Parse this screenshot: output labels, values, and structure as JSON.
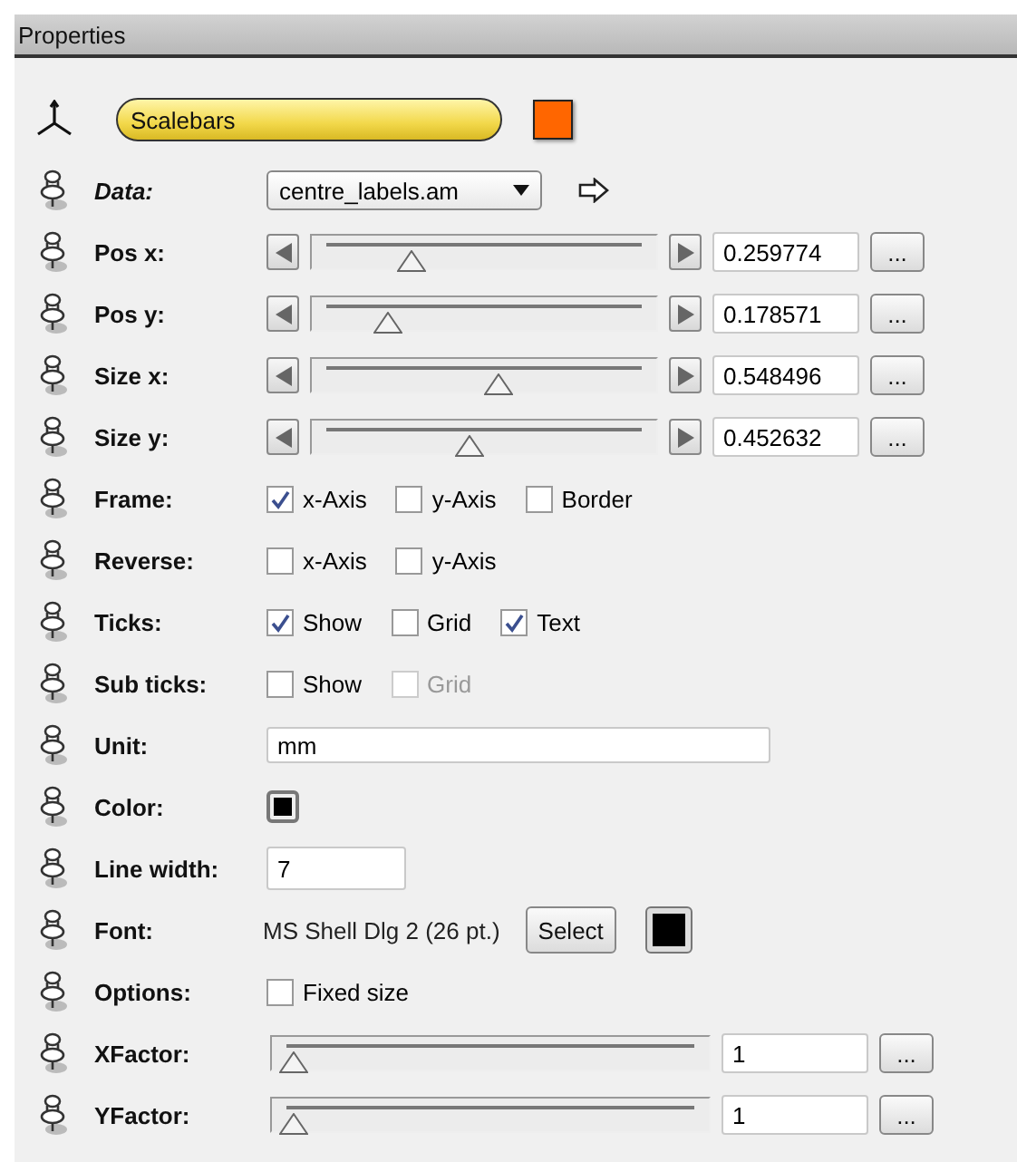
{
  "panel": {
    "title": "Properties"
  },
  "header": {
    "name": "Scalebars",
    "color": "#ff6600"
  },
  "rows": [
    {
      "kind": "dropdown",
      "label": "Data:",
      "italic": true,
      "value": "centre_labels.am"
    },
    {
      "kind": "slider",
      "label": "Pos x:",
      "arrows": true,
      "level": 0.26,
      "value": "0.259774",
      "button": "..."
    },
    {
      "kind": "slider",
      "label": "Pos y:",
      "arrows": true,
      "level": 0.18,
      "value": "0.178571",
      "button": "..."
    },
    {
      "kind": "slider",
      "label": "Size x:",
      "arrows": true,
      "level": 0.55,
      "value": "0.548496",
      "button": "..."
    },
    {
      "kind": "slider",
      "label": "Size y:",
      "arrows": true,
      "level": 0.45,
      "value": "0.452632",
      "button": "..."
    },
    {
      "kind": "checks",
      "label": "Frame:",
      "options": [
        {
          "label": "x-Axis",
          "checked": true,
          "disabled": false
        },
        {
          "label": "y-Axis",
          "checked": false,
          "disabled": false
        },
        {
          "label": "Border",
          "checked": false,
          "disabled": false
        }
      ]
    },
    {
      "kind": "checks",
      "label": "Reverse:",
      "options": [
        {
          "label": "x-Axis",
          "checked": false,
          "disabled": false
        },
        {
          "label": "y-Axis",
          "checked": false,
          "disabled": false
        }
      ]
    },
    {
      "kind": "checks",
      "label": "Ticks:",
      "options": [
        {
          "label": "Show",
          "checked": true,
          "disabled": false
        },
        {
          "label": "Grid",
          "checked": false,
          "disabled": false
        },
        {
          "label": "Text",
          "checked": true,
          "disabled": false
        }
      ]
    },
    {
      "kind": "checks",
      "label": "Sub ticks:",
      "options": [
        {
          "label": "Show",
          "checked": false,
          "disabled": false
        },
        {
          "label": "Grid",
          "checked": false,
          "disabled": true
        }
      ]
    },
    {
      "kind": "text",
      "label": "Unit:",
      "value": "mm"
    },
    {
      "kind": "color",
      "label": "Color:",
      "color": "#000000"
    },
    {
      "kind": "number",
      "label": "Line width:",
      "value": "7"
    },
    {
      "kind": "font",
      "label": "Font:",
      "value": "MS Shell Dlg 2 (26 pt.)",
      "button": "Select",
      "color": "#000000"
    },
    {
      "kind": "checks",
      "label": "Options:",
      "options": [
        {
          "label": "Fixed size",
          "checked": false,
          "disabled": false
        }
      ]
    },
    {
      "kind": "slider",
      "label": "XFactor:",
      "arrows": false,
      "level": 0,
      "value": "1",
      "button": "..."
    },
    {
      "kind": "slider",
      "label": "YFactor:",
      "arrows": false,
      "level": 0,
      "value": "1",
      "button": "..."
    }
  ]
}
